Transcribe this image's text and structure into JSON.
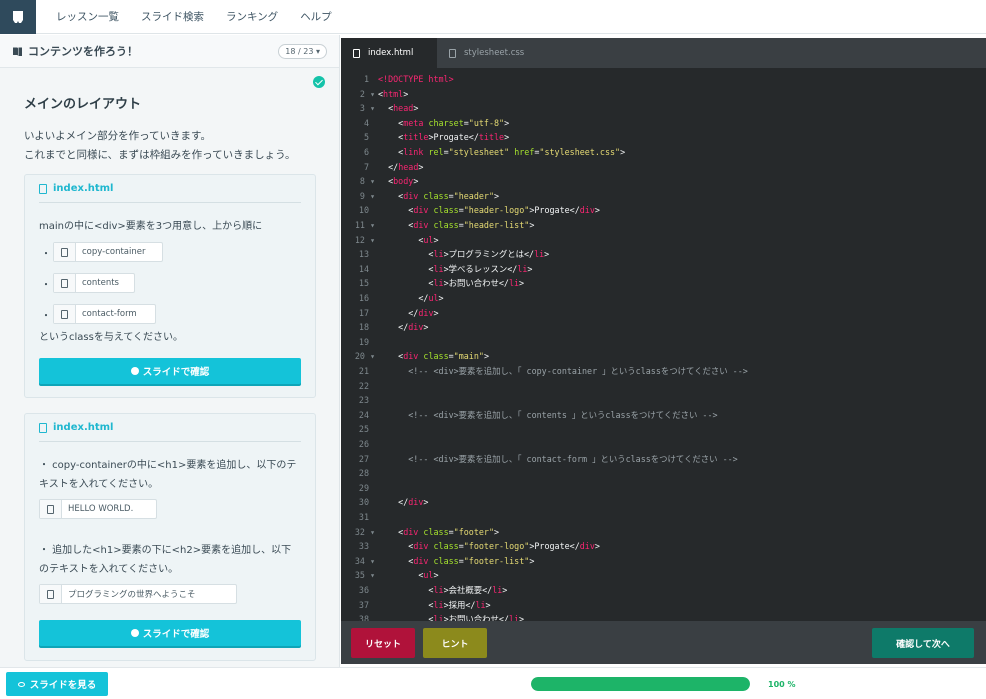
{
  "colors": {
    "accent": "#14c3d9",
    "reset": "#b0123a",
    "hint": "#8c8a1c",
    "next": "#0e7a69",
    "progress": "#1db468"
  },
  "nav": {
    "items": [
      "レッスン一覧",
      "スライド検索",
      "ランキング",
      "ヘルプ"
    ]
  },
  "left": {
    "header_title": "コンテンツを作ろう！",
    "page_indicator": "18 / 23",
    "section_title": "メインのレイアウト",
    "intro_lines": [
      "いよいよメイン部分を作っていきます。",
      "これまでと同様に、まずは枠組みを作っていきましょう。"
    ],
    "card1": {
      "file": "index.html",
      "text1": "mainの中に<div>要素を3つ用意し、上から順に",
      "chips": [
        "copy-container",
        "contents",
        "contact-form"
      ],
      "text2": "というclassを与えてください。",
      "button": "スライドで確認"
    },
    "card2": {
      "file": "index.html",
      "text1_lines": [
        "・ copy-containerの中に<h1>要素を追加し、以下のテ",
        "キストを入れてください。"
      ],
      "chip1": "HELLO WORLD.",
      "text2_lines": [
        "・ 追加した<h1>要素の下に<h2>要素を追加し、以下",
        "のテキストを入れてください。"
      ],
      "chip2": "プログラミングの世界へようこそ",
      "button": "スライドで確認"
    }
  },
  "editor": {
    "tabs": [
      {
        "label": "index.html",
        "active": true
      },
      {
        "label": "stylesheet.css",
        "active": false
      }
    ],
    "lines": [
      {
        "n": "1",
        "f": false,
        "segs": [
          [
            "t",
            "<!DOCTYPE html>"
          ]
        ]
      },
      {
        "n": "2",
        "f": true,
        "segs": [
          [
            "p",
            "<"
          ],
          [
            "t",
            "html"
          ],
          [
            "p",
            ">"
          ]
        ]
      },
      {
        "n": "3",
        "f": true,
        "segs": [
          [
            "x",
            "  "
          ],
          [
            "p",
            "<"
          ],
          [
            "t",
            "head"
          ],
          [
            "p",
            ">"
          ]
        ]
      },
      {
        "n": "4",
        "f": false,
        "segs": [
          [
            "x",
            "    "
          ],
          [
            "p",
            "<"
          ],
          [
            "t",
            "meta"
          ],
          [
            "x",
            " "
          ],
          [
            "a",
            "charset"
          ],
          [
            "p",
            "="
          ],
          [
            "s",
            "\"utf-8\""
          ],
          [
            "p",
            ">"
          ]
        ]
      },
      {
        "n": "5",
        "f": false,
        "segs": [
          [
            "x",
            "    "
          ],
          [
            "p",
            "<"
          ],
          [
            "t",
            "title"
          ],
          [
            "p",
            ">Progate</"
          ],
          [
            "t",
            "title"
          ],
          [
            "p",
            ">"
          ]
        ]
      },
      {
        "n": "6",
        "f": false,
        "segs": [
          [
            "x",
            "    "
          ],
          [
            "p",
            "<"
          ],
          [
            "t",
            "link"
          ],
          [
            "x",
            " "
          ],
          [
            "a",
            "rel"
          ],
          [
            "p",
            "="
          ],
          [
            "s",
            "\"stylesheet\""
          ],
          [
            "x",
            " "
          ],
          [
            "a",
            "href"
          ],
          [
            "p",
            "="
          ],
          [
            "s",
            "\"stylesheet.css\""
          ],
          [
            "p",
            ">"
          ]
        ]
      },
      {
        "n": "7",
        "f": false,
        "segs": [
          [
            "x",
            "  "
          ],
          [
            "p",
            "</"
          ],
          [
            "t",
            "head"
          ],
          [
            "p",
            ">"
          ]
        ]
      },
      {
        "n": "8",
        "f": true,
        "segs": [
          [
            "x",
            "  "
          ],
          [
            "p",
            "<"
          ],
          [
            "t",
            "body"
          ],
          [
            "p",
            ">"
          ]
        ]
      },
      {
        "n": "9",
        "f": true,
        "segs": [
          [
            "x",
            "    "
          ],
          [
            "p",
            "<"
          ],
          [
            "t",
            "div"
          ],
          [
            "x",
            " "
          ],
          [
            "a",
            "class"
          ],
          [
            "p",
            "="
          ],
          [
            "s",
            "\"header\""
          ],
          [
            "p",
            ">"
          ]
        ]
      },
      {
        "n": "10",
        "f": false,
        "segs": [
          [
            "x",
            "      "
          ],
          [
            "p",
            "<"
          ],
          [
            "t",
            "div"
          ],
          [
            "x",
            " "
          ],
          [
            "a",
            "class"
          ],
          [
            "p",
            "="
          ],
          [
            "s",
            "\"header-logo\""
          ],
          [
            "p",
            ">Progate</"
          ],
          [
            "t",
            "div"
          ],
          [
            "p",
            ">"
          ]
        ]
      },
      {
        "n": "11",
        "f": true,
        "segs": [
          [
            "x",
            "      "
          ],
          [
            "p",
            "<"
          ],
          [
            "t",
            "div"
          ],
          [
            "x",
            " "
          ],
          [
            "a",
            "class"
          ],
          [
            "p",
            "="
          ],
          [
            "s",
            "\"header-list\""
          ],
          [
            "p",
            ">"
          ]
        ]
      },
      {
        "n": "12",
        "f": true,
        "segs": [
          [
            "x",
            "        "
          ],
          [
            "p",
            "<"
          ],
          [
            "t",
            "ul"
          ],
          [
            "p",
            ">"
          ]
        ]
      },
      {
        "n": "13",
        "f": false,
        "segs": [
          [
            "x",
            "          "
          ],
          [
            "p",
            "<"
          ],
          [
            "t",
            "li"
          ],
          [
            "p",
            ">プログラミングとは</"
          ],
          [
            "t",
            "li"
          ],
          [
            "p",
            ">"
          ]
        ]
      },
      {
        "n": "14",
        "f": false,
        "segs": [
          [
            "x",
            "          "
          ],
          [
            "p",
            "<"
          ],
          [
            "t",
            "li"
          ],
          [
            "p",
            ">学べるレッスン</"
          ],
          [
            "t",
            "li"
          ],
          [
            "p",
            ">"
          ]
        ]
      },
      {
        "n": "15",
        "f": false,
        "segs": [
          [
            "x",
            "          "
          ],
          [
            "p",
            "<"
          ],
          [
            "t",
            "li"
          ],
          [
            "p",
            ">お問い合わせ</"
          ],
          [
            "t",
            "li"
          ],
          [
            "p",
            ">"
          ]
        ]
      },
      {
        "n": "16",
        "f": false,
        "segs": [
          [
            "x",
            "        "
          ],
          [
            "p",
            "</"
          ],
          [
            "t",
            "ul"
          ],
          [
            "p",
            ">"
          ]
        ]
      },
      {
        "n": "17",
        "f": false,
        "segs": [
          [
            "x",
            "      "
          ],
          [
            "p",
            "</"
          ],
          [
            "t",
            "div"
          ],
          [
            "p",
            ">"
          ]
        ]
      },
      {
        "n": "18",
        "f": false,
        "segs": [
          [
            "x",
            "    "
          ],
          [
            "p",
            "</"
          ],
          [
            "t",
            "div"
          ],
          [
            "p",
            ">"
          ]
        ]
      },
      {
        "n": "19",
        "f": false,
        "segs": []
      },
      {
        "n": "20",
        "f": true,
        "segs": [
          [
            "x",
            "    "
          ],
          [
            "p",
            "<"
          ],
          [
            "t",
            "div"
          ],
          [
            "x",
            " "
          ],
          [
            "a",
            "class"
          ],
          [
            "p",
            "="
          ],
          [
            "s",
            "\"main\""
          ],
          [
            "p",
            ">"
          ]
        ]
      },
      {
        "n": "21",
        "f": false,
        "segs": [
          [
            "x",
            "      "
          ],
          [
            "c",
            "<!-- <div>要素を追加し、「 copy-container 」というclassをつけてください -->"
          ]
        ]
      },
      {
        "n": "22",
        "f": false,
        "segs": []
      },
      {
        "n": "23",
        "f": false,
        "segs": []
      },
      {
        "n": "24",
        "f": false,
        "segs": [
          [
            "x",
            "      "
          ],
          [
            "c",
            "<!-- <div>要素を追加し、「 contents 」というclassをつけてください -->"
          ]
        ]
      },
      {
        "n": "25",
        "f": false,
        "segs": []
      },
      {
        "n": "26",
        "f": false,
        "segs": []
      },
      {
        "n": "27",
        "f": false,
        "segs": [
          [
            "x",
            "      "
          ],
          [
            "c",
            "<!-- <div>要素を追加し、「 contact-form 」というclassをつけてください -->"
          ]
        ]
      },
      {
        "n": "28",
        "f": false,
        "segs": []
      },
      {
        "n": "29",
        "f": false,
        "segs": []
      },
      {
        "n": "30",
        "f": false,
        "segs": [
          [
            "x",
            "    "
          ],
          [
            "p",
            "</"
          ],
          [
            "t",
            "div"
          ],
          [
            "p",
            ">"
          ]
        ]
      },
      {
        "n": "31",
        "f": false,
        "segs": []
      },
      {
        "n": "32",
        "f": true,
        "segs": [
          [
            "x",
            "    "
          ],
          [
            "p",
            "<"
          ],
          [
            "t",
            "div"
          ],
          [
            "x",
            " "
          ],
          [
            "a",
            "class"
          ],
          [
            "p",
            "="
          ],
          [
            "s",
            "\"footer\""
          ],
          [
            "p",
            ">"
          ]
        ]
      },
      {
        "n": "33",
        "f": false,
        "segs": [
          [
            "x",
            "      "
          ],
          [
            "p",
            "<"
          ],
          [
            "t",
            "div"
          ],
          [
            "x",
            " "
          ],
          [
            "a",
            "class"
          ],
          [
            "p",
            "="
          ],
          [
            "s",
            "\"footer-logo\""
          ],
          [
            "p",
            ">Progate</"
          ],
          [
            "t",
            "div"
          ],
          [
            "p",
            ">"
          ]
        ]
      },
      {
        "n": "34",
        "f": true,
        "segs": [
          [
            "x",
            "      "
          ],
          [
            "p",
            "<"
          ],
          [
            "t",
            "div"
          ],
          [
            "x",
            " "
          ],
          [
            "a",
            "class"
          ],
          [
            "p",
            "="
          ],
          [
            "s",
            "\"footer-list\""
          ],
          [
            "p",
            ">"
          ]
        ]
      },
      {
        "n": "35",
        "f": true,
        "segs": [
          [
            "x",
            "        "
          ],
          [
            "p",
            "<"
          ],
          [
            "t",
            "ul"
          ],
          [
            "p",
            ">"
          ]
        ]
      },
      {
        "n": "36",
        "f": false,
        "segs": [
          [
            "x",
            "          "
          ],
          [
            "p",
            "<"
          ],
          [
            "t",
            "li"
          ],
          [
            "p",
            ">会社概要</"
          ],
          [
            "t",
            "li"
          ],
          [
            "p",
            ">"
          ]
        ]
      },
      {
        "n": "37",
        "f": false,
        "segs": [
          [
            "x",
            "          "
          ],
          [
            "p",
            "<"
          ],
          [
            "t",
            "li"
          ],
          [
            "p",
            ">採用</"
          ],
          [
            "t",
            "li"
          ],
          [
            "p",
            ">"
          ]
        ]
      },
      {
        "n": "38",
        "f": false,
        "segs": [
          [
            "x",
            "          "
          ],
          [
            "p",
            "<"
          ],
          [
            "t",
            "li"
          ],
          [
            "p",
            ">お問い合わせ</"
          ],
          [
            "t",
            "li"
          ],
          [
            "p",
            ">"
          ]
        ]
      }
    ],
    "buttons": {
      "reset": "リセット",
      "hint": "ヒント",
      "next": "確認して次へ"
    }
  },
  "bottom": {
    "slide_button": "スライドを見る",
    "progress_value": 1.0,
    "progress_label": "100 %"
  }
}
